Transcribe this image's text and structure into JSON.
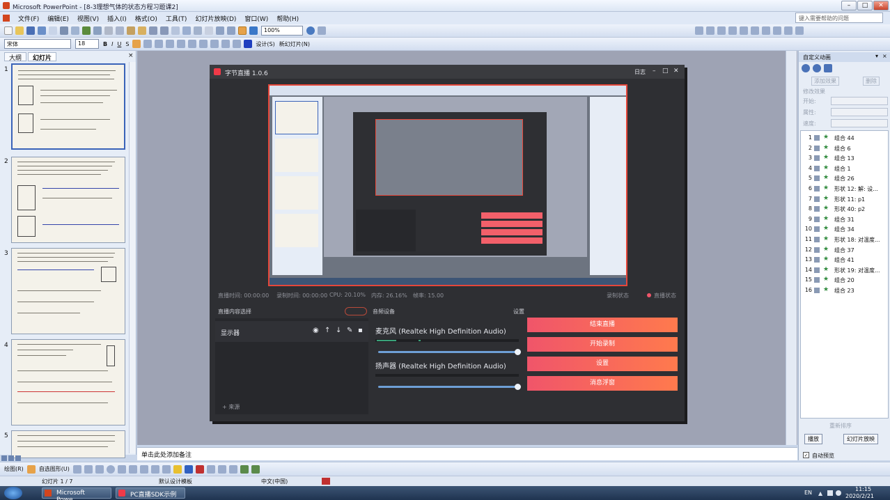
{
  "window": {
    "title": "Microsoft PowerPoint - [8-3理想气体的状态方程习题课2]"
  },
  "menu": [
    "文件(F)",
    "编辑(E)",
    "视图(V)",
    "插入(I)",
    "格式(O)",
    "工具(T)",
    "幻灯片放映(D)",
    "窗口(W)",
    "帮助(H)"
  ],
  "help_placeholder": "键入需要帮助的问题",
  "toolbar": {
    "zoom": "100%",
    "font": "宋体",
    "font_size": "18",
    "bold": "B",
    "italic": "I",
    "underline": "U",
    "shadow": "S",
    "design": "设计(S)",
    "new_slide": "新幻灯片(N)"
  },
  "left_panel": {
    "tab_outline": "大纲",
    "tab_slides": "幻灯片",
    "slide_numbers": [
      "1",
      "2",
      "3",
      "4",
      "5"
    ]
  },
  "live_app": {
    "title": "字节直播 1.0.6",
    "log": "日志",
    "stats": [
      "直播时间: 00:00:00",
      "录制时间: 00:00:00",
      "CPU: 20.10%",
      "内存: 26.16%",
      "帧率: 15.00"
    ],
    "record_state": "录制状态",
    "live_state": "直播状态",
    "sources_header": "直播内容选择",
    "audio_header": "音频设备",
    "settings_header": "设置",
    "source_name": "显示器",
    "add_source": "+ 来源",
    "mic_label": "麦克风 (Realtek High Definition Audio)",
    "speaker_label": "扬声器 (Realtek High Definition Audio)",
    "buttons": [
      "结束直播",
      "开始录制",
      "设置",
      "消息浮窗"
    ],
    "mic_volume": 1.0,
    "speaker_volume": 1.0
  },
  "notes_placeholder": "单击此处添加备注",
  "right_panel": {
    "title": "自定义动画",
    "add_effect": "添加效果",
    "remove": "删除",
    "modify": "修改效果",
    "start": "开始:",
    "property": "属性:",
    "speed": "速度:",
    "items": [
      {
        "n": "1",
        "name": "组合 44"
      },
      {
        "n": "2",
        "name": "组合 6"
      },
      {
        "n": "3",
        "name": "组合 13"
      },
      {
        "n": "4",
        "name": "组合 1"
      },
      {
        "n": "5",
        "name": "组合 26"
      },
      {
        "n": "6",
        "name": "形状 12: 解: 设..."
      },
      {
        "n": "7",
        "name": "形状 11: p1"
      },
      {
        "n": "8",
        "name": "形状 40: p2"
      },
      {
        "n": "9",
        "name": "组合 31"
      },
      {
        "n": "10",
        "name": "组合 34"
      },
      {
        "n": "11",
        "name": "形状 18: 对温度..."
      },
      {
        "n": "12",
        "name": "组合 37"
      },
      {
        "n": "13",
        "name": "组合 41"
      },
      {
        "n": "14",
        "name": "形状 19: 对温度..."
      },
      {
        "n": "15",
        "name": "组合 20"
      },
      {
        "n": "16",
        "name": "组合 23"
      }
    ],
    "reorder": "重新排序",
    "play": "播放",
    "slideshow": "幻灯片放映",
    "autopreview": "自动预览"
  },
  "drawbar": {
    "draw": "绘图(R)",
    "autoshape": "自选图形(U)"
  },
  "statusbar": {
    "slide": "幻灯片 1 / 7",
    "template": "默认设计模板",
    "lang": "中文(中国)"
  },
  "taskbar": {
    "tasks": [
      "Microsoft Powe...",
      "PC直播SDK示例"
    ],
    "lang": "EN",
    "time": "11:15",
    "date": "2020/2/21"
  }
}
